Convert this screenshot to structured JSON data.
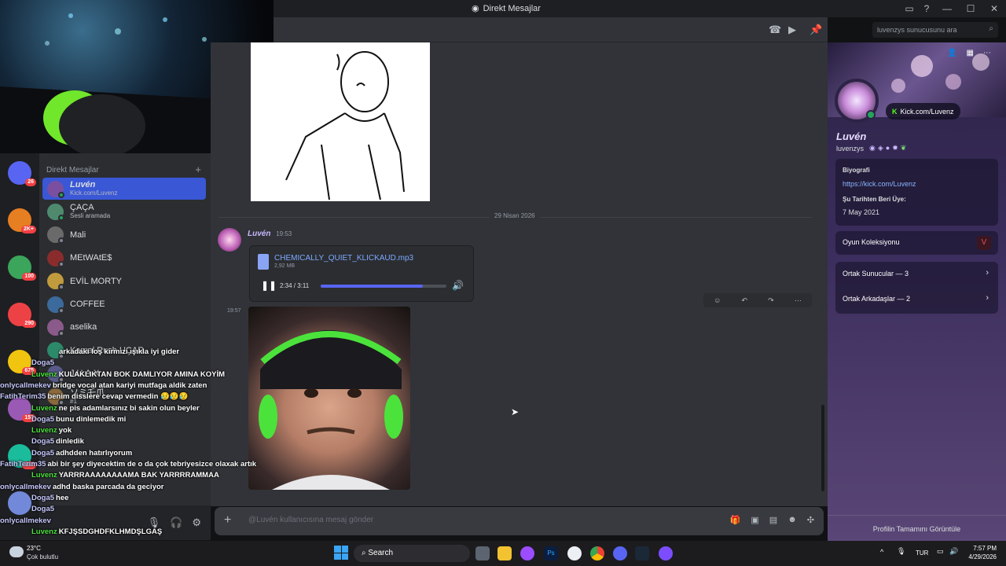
{
  "window": {
    "title": "Direkt Mesajlar",
    "search_placeholder": "luvenzys sunucusunu ara"
  },
  "servers": [
    {
      "badge": "26"
    },
    {
      "badge": "2K+"
    },
    {
      "badge": "100"
    },
    {
      "badge": "290"
    },
    {
      "badge": "675"
    },
    {
      "badge": "153"
    },
    {
      "badge": "282"
    },
    {
      "badge": ""
    }
  ],
  "dm": {
    "header": "Direkt Mesajlar",
    "add_icon": "+",
    "items": [
      {
        "name": "Luvén",
        "sub": "Kick.com/Luvenz",
        "active": true
      },
      {
        "name": "ÇAÇA",
        "sub": "Sesli aramada"
      },
      {
        "name": "Mali",
        "sub": ""
      },
      {
        "name": "MEtWAtE$",
        "sub": ""
      },
      {
        "name": "EVİL MORTY",
        "sub": ""
      },
      {
        "name": "COFFEE",
        "sub": ""
      },
      {
        "name": "aselika",
        "sub": ""
      },
      {
        "name": "Kamal Rush UÇAR",
        "sub": ""
      },
      {
        "name": "J.U.A.X",
        "sub": ""
      },
      {
        "name": "ソミ乇爪",
        "sub": "#1"
      }
    ]
  },
  "chat": {
    "date_divider": "29 Nisan 2026",
    "message1": {
      "author": "Luvén",
      "time": "19:53"
    },
    "audio": {
      "filename": "CHEMICALLY_QUIET_KLICKAUD.mp3",
      "size": "2,92 MB",
      "position": "2:34 / 3:11",
      "progress": 0.81
    },
    "message2": {
      "time": "19:57"
    },
    "input_placeholder": "@Luvén kullanıcısına mesaj gönder"
  },
  "profile": {
    "display_name": "Luvén",
    "username": "luvenzys",
    "connection": "Kick.com/Luvenz",
    "bio_label": "Biyografi",
    "bio_link": "https://kick.com/Luvenz",
    "member_since_label": "Şu Tarihten Beri Üye:",
    "member_since": "7 May 2021",
    "game_collection": "Oyun Koleksiyonu",
    "mutual_servers": "Ortak Sunucular — 3",
    "mutual_friends": "Ortak Arkadaşlar — 2",
    "view_full": "Profilin Tamamını Görüntüle"
  },
  "overlay_chat": [
    {
      "user": "",
      "msg": "arkadaki loş kırmızı ışıkla iyi gider",
      "color": "#fff"
    },
    {
      "user": "Doga5",
      "msg": "",
      "color": "#c7c9ff"
    },
    {
      "user": "Luvenz",
      "msg": "KULAKLIKTAN BOK DAMLIYOR AMINA KOYİM",
      "color": "#4be33b"
    },
    {
      "user": "onlycallmekev",
      "msg": "bridge vocal atan kariyi mutfaga aldik zaten",
      "color": "#c7c9ff"
    },
    {
      "user": "FatihTerim35",
      "msg": "benim disslere cevap vermedin 😥😥😥",
      "color": "#c7c9ff"
    },
    {
      "user": "Luvenz",
      "msg": "ne pis adamlarsınız bi sakin olun beyler",
      "color": "#4be33b"
    },
    {
      "user": "Doga5",
      "msg": "bunu dinlemedik mi",
      "color": "#c7c9ff"
    },
    {
      "user": "Luvenz",
      "msg": "yok",
      "color": "#4be33b"
    },
    {
      "user": "Doga5",
      "msg": "dinledik",
      "color": "#c7c9ff"
    },
    {
      "user": "Doga5",
      "msg": "adhdden hatırlıyorum",
      "color": "#c7c9ff"
    },
    {
      "user": "FatihTerim35",
      "msg": "abi bir şey diyecektim de o da çok tebriyesizce olaxak artık",
      "color": "#c7c9ff"
    },
    {
      "user": "Luvenz",
      "msg": "YARRRAAAAAAAAMA BAK YARRRRAMMAA",
      "color": "#4be33b"
    },
    {
      "user": "onlycallmekev",
      "msg": "adhd baska parcada da geciyor",
      "color": "#c7c9ff"
    },
    {
      "user": "Doga5",
      "msg": "hee",
      "color": "#c7c9ff"
    },
    {
      "user": "Doga5",
      "msg": "",
      "color": "#c7c9ff"
    },
    {
      "user": "onlycallmekev",
      "msg": "",
      "color": "#c7c9ff"
    },
    {
      "user": "Luvenz",
      "msg": "KFJŞSDGHDFKLHMDŞLGAŞ",
      "color": "#4be33b"
    }
  ],
  "taskbar": {
    "weather_temp": "23°C",
    "weather_desc": "Çok bulutlu",
    "search": "Search",
    "language": "TUR",
    "time": "7:57 PM",
    "date": "4/29/2026"
  }
}
